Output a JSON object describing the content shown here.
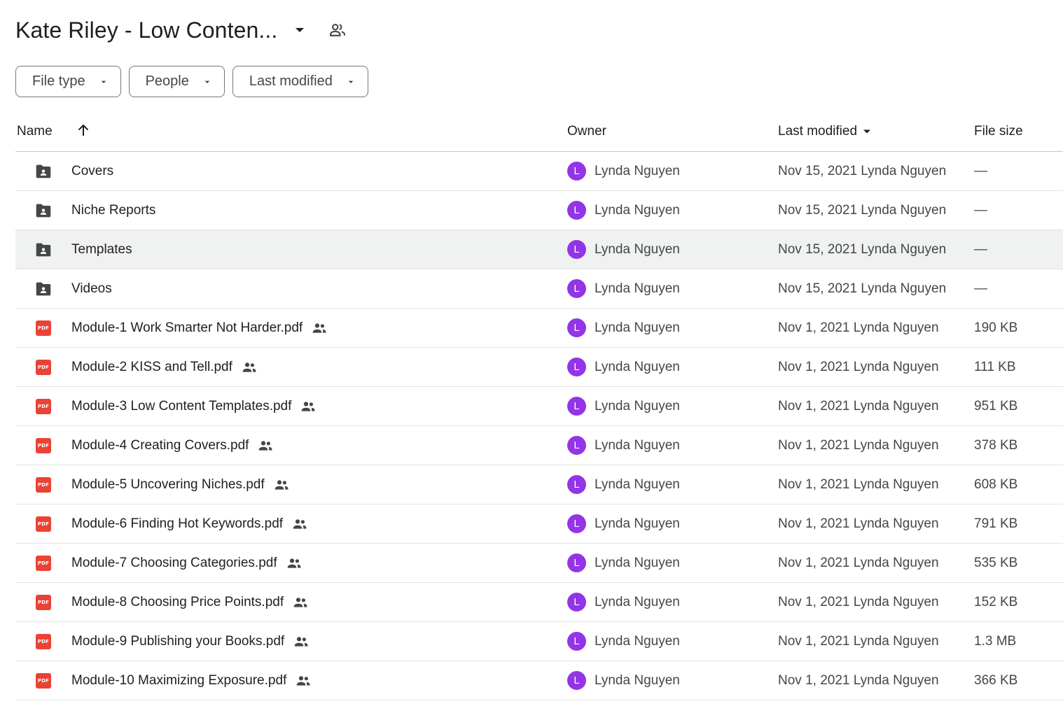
{
  "colors": {
    "avatar": "#9334e6",
    "pdf": "#ea4335",
    "folder": "#444746",
    "selected_row": "#f0f1f1"
  },
  "header": {
    "title": "Kate Riley - Low Conten...",
    "title_caret_icon": "arrow-drop-down-icon",
    "shared_icon": "people-outline-icon"
  },
  "filters": [
    {
      "label": "File type",
      "icon": "arrow-drop-down-icon"
    },
    {
      "label": "People",
      "icon": "arrow-drop-down-icon"
    },
    {
      "label": "Last modified",
      "icon": "arrow-drop-down-icon"
    }
  ],
  "columns": {
    "name": "Name",
    "owner": "Owner",
    "last_modified": "Last modified",
    "file_size": "File size"
  },
  "rows": [
    {
      "type": "folder",
      "name": "Covers",
      "shared": false,
      "owner": "Lynda Nguyen",
      "avatar": "L",
      "modified": "Nov 15, 2021 Lynda Nguyen",
      "size": "—",
      "selected": false
    },
    {
      "type": "folder",
      "name": "Niche Reports",
      "shared": false,
      "owner": "Lynda Nguyen",
      "avatar": "L",
      "modified": "Nov 15, 2021 Lynda Nguyen",
      "size": "—",
      "selected": false
    },
    {
      "type": "folder",
      "name": "Templates",
      "shared": false,
      "owner": "Lynda Nguyen",
      "avatar": "L",
      "modified": "Nov 15, 2021 Lynda Nguyen",
      "size": "—",
      "selected": true
    },
    {
      "type": "folder",
      "name": "Videos",
      "shared": false,
      "owner": "Lynda Nguyen",
      "avatar": "L",
      "modified": "Nov 15, 2021 Lynda Nguyen",
      "size": "—",
      "selected": false
    },
    {
      "type": "pdf",
      "name": "Module-1 Work Smarter Not Harder.pdf",
      "shared": true,
      "owner": "Lynda Nguyen",
      "avatar": "L",
      "modified": "Nov 1, 2021 Lynda Nguyen",
      "size": "190 KB",
      "selected": false
    },
    {
      "type": "pdf",
      "name": "Module-2 KISS and Tell.pdf",
      "shared": true,
      "owner": "Lynda Nguyen",
      "avatar": "L",
      "modified": "Nov 1, 2021 Lynda Nguyen",
      "size": "111 KB",
      "selected": false
    },
    {
      "type": "pdf",
      "name": "Module-3 Low Content Templates.pdf",
      "shared": true,
      "owner": "Lynda Nguyen",
      "avatar": "L",
      "modified": "Nov 1, 2021 Lynda Nguyen",
      "size": "951 KB",
      "selected": false
    },
    {
      "type": "pdf",
      "name": "Module-4 Creating Covers.pdf",
      "shared": true,
      "owner": "Lynda Nguyen",
      "avatar": "L",
      "modified": "Nov 1, 2021 Lynda Nguyen",
      "size": "378 KB",
      "selected": false
    },
    {
      "type": "pdf",
      "name": "Module-5 Uncovering Niches.pdf",
      "shared": true,
      "owner": "Lynda Nguyen",
      "avatar": "L",
      "modified": "Nov 1, 2021 Lynda Nguyen",
      "size": "608 KB",
      "selected": false
    },
    {
      "type": "pdf",
      "name": "Module-6 Finding Hot Keywords.pdf",
      "shared": true,
      "owner": "Lynda Nguyen",
      "avatar": "L",
      "modified": "Nov 1, 2021 Lynda Nguyen",
      "size": "791 KB",
      "selected": false
    },
    {
      "type": "pdf",
      "name": "Module-7 Choosing Categories.pdf",
      "shared": true,
      "owner": "Lynda Nguyen",
      "avatar": "L",
      "modified": "Nov 1, 2021 Lynda Nguyen",
      "size": "535 KB",
      "selected": false
    },
    {
      "type": "pdf",
      "name": "Module-8 Choosing Price Points.pdf",
      "shared": true,
      "owner": "Lynda Nguyen",
      "avatar": "L",
      "modified": "Nov 1, 2021 Lynda Nguyen",
      "size": "152 KB",
      "selected": false
    },
    {
      "type": "pdf",
      "name": "Module-9 Publishing your Books.pdf",
      "shared": true,
      "owner": "Lynda Nguyen",
      "avatar": "L",
      "modified": "Nov 1, 2021 Lynda Nguyen",
      "size": "1.3 MB",
      "selected": false
    },
    {
      "type": "pdf",
      "name": "Module-10 Maximizing Exposure.pdf",
      "shared": true,
      "owner": "Lynda Nguyen",
      "avatar": "L",
      "modified": "Nov 1, 2021 Lynda Nguyen",
      "size": "366 KB",
      "selected": false
    }
  ]
}
